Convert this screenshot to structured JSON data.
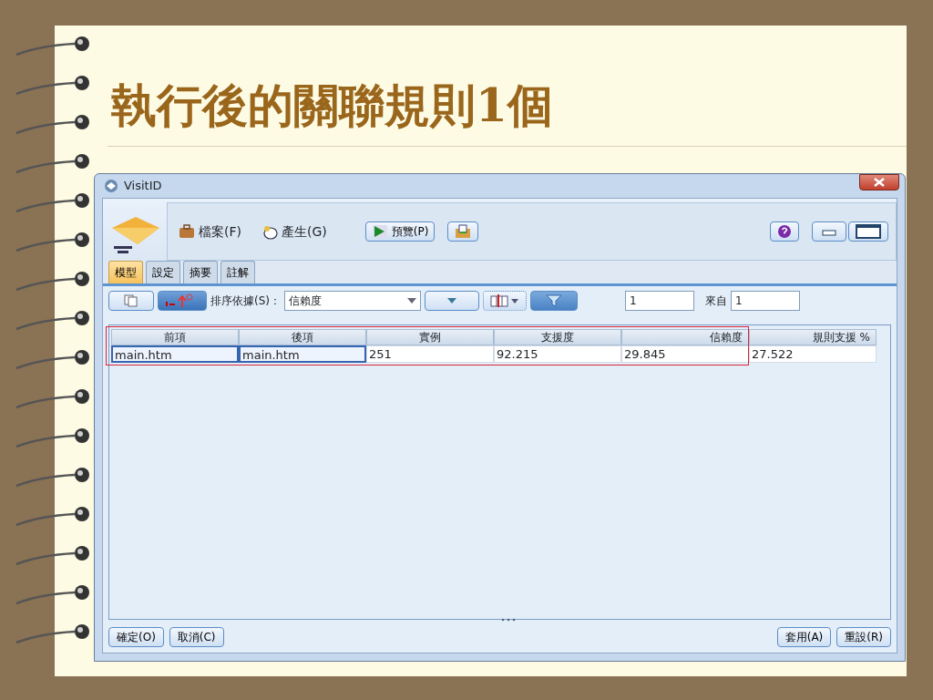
{
  "slide": {
    "title": "執行後的關聯規則1個"
  },
  "window": {
    "title": "VisitID"
  },
  "menu": [
    {
      "label": "檔案(F)",
      "kind": "briefcase"
    },
    {
      "label": "產生(G)",
      "kind": "generate"
    }
  ],
  "preview_button": {
    "label": "預覽(P)"
  },
  "tabs": [
    {
      "label": "模型",
      "selected": true
    },
    {
      "label": "設定",
      "selected": false
    },
    {
      "label": "摘要",
      "selected": false
    },
    {
      "label": "註解",
      "selected": false
    }
  ],
  "toolbar": {
    "sort_label": "排序依據(S)：",
    "sort_value": "信賴度",
    "range_start": "1",
    "from_label": "來自",
    "range_total": "1"
  },
  "table": {
    "highlight_frame": true,
    "columns": [
      "前項",
      "後項",
      "實例",
      "支援度",
      "信賴度",
      "規則支援 %"
    ],
    "rows": [
      [
        {
          "text": "main.htm",
          "selected": true
        },
        {
          "text": "main.htm",
          "selected": true
        },
        {
          "text": "251",
          "selected": false
        },
        {
          "text": "92.215",
          "selected": false
        },
        {
          "text": "29.845",
          "selected": false
        },
        {
          "text": "27.522",
          "selected": false
        }
      ]
    ]
  },
  "buttons_left": [
    "確定(O)",
    "取消(C)"
  ],
  "buttons_right": [
    "套用(A)",
    "重設(R)"
  ]
}
